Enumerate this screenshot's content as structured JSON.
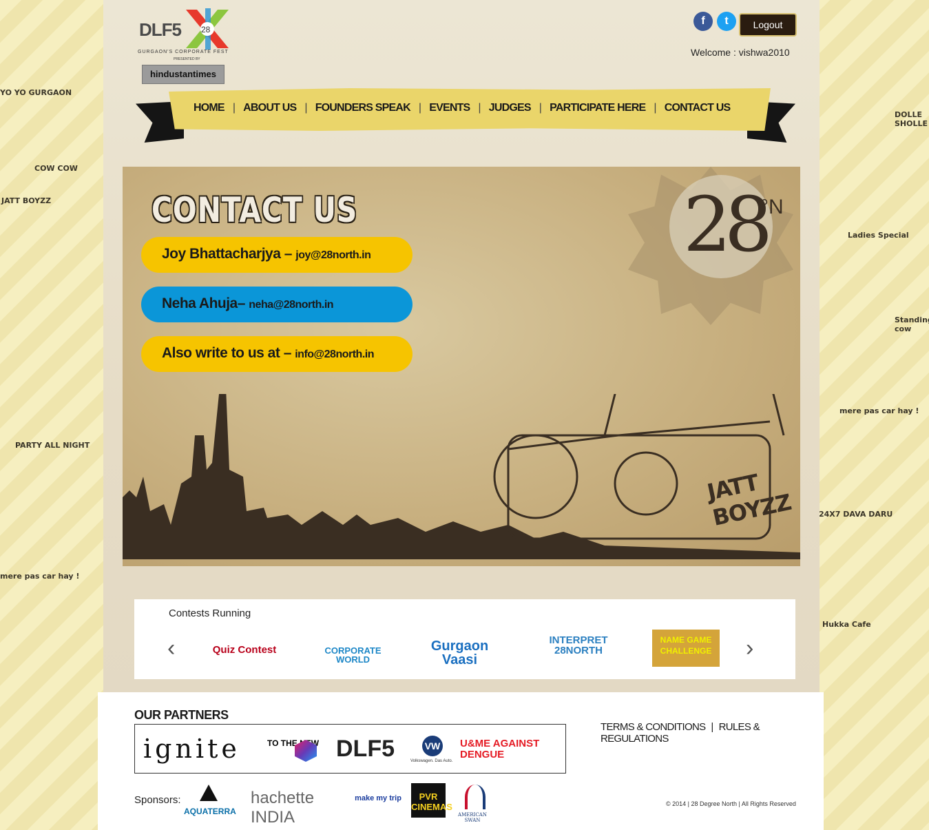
{
  "header": {
    "logo": {
      "brand": "DLF5",
      "badge": "28",
      "tagline": "GURGAON'S CORPORATE FEST",
      "presented_by": "PRESENTED BY",
      "partner": "hindustantimes"
    },
    "social": [
      {
        "name": "facebook-icon",
        "glyph": "f",
        "color": "#3b5998"
      },
      {
        "name": "twitter-icon",
        "glyph": "t",
        "color": "#1da1f2"
      }
    ],
    "logout_label": "Logout",
    "welcome": "Welcome : vishwa2010"
  },
  "nav": {
    "items": [
      "HOME",
      "ABOUT US",
      "FOUNDERS SPEAK",
      "EVENTS",
      "JUDGES",
      "PARTICIPATE HERE",
      "CONTACT US"
    ],
    "separator": "|"
  },
  "hero": {
    "title": "CONTACT US",
    "contacts": [
      {
        "name": "Joy Bhattacharjya –",
        "email": "joy@28north.in",
        "color": "#f6c400"
      },
      {
        "name": "Neha Ahuja–",
        "email": "neha@28north.in",
        "color": "#0b96d8"
      },
      {
        "name": "Also write to us at –",
        "email": "info@28north.in",
        "color": "#f6c400"
      }
    ],
    "seal": {
      "number": "28",
      "suffix": "°N"
    },
    "jeep_text": "JATT BOYZZ"
  },
  "contests": {
    "label": "Contests Running",
    "prev_glyph": "‹",
    "next_glyph": "›",
    "logos": [
      {
        "text": "Quiz Contest",
        "color": "#b8001a"
      },
      {
        "text": "CORPORATE WORLD",
        "color": "#1d87c7"
      },
      {
        "text": "Gurgaon Vaasi",
        "color": "#1a6fc0"
      },
      {
        "text": "INTERPRET 28NORTH",
        "color": "#2a7fc0"
      },
      {
        "text": "NAME GAME CHALLENGE",
        "color": "#f0c800"
      }
    ]
  },
  "footer": {
    "partners_title": "OUR PARTNERS",
    "partners": [
      "ignite",
      "TO THE NEW",
      "DLF5",
      "Volkswagen. Das Auto.",
      "U&ME AGAINST DENGUE"
    ],
    "links": [
      "TERMS & CONDITIONS",
      "RULES & REGULATIONS"
    ],
    "link_separator": "|",
    "sponsors_label": "Sponsors:",
    "sponsors": [
      "AQUATERRA",
      "hachette INDIA",
      "make my trip",
      "PVR CINEMAS",
      "AMERICAN SWAN"
    ],
    "copyright": "© 2014 | 28 Degree North | All Rights Reserved"
  },
  "doodles": [
    "YO YO GURGAON",
    "COW COW",
    "JATT BOYZZ",
    "PARTY ALL NIGHT",
    "mere pas car hay !",
    "DOLLE SHOLLE",
    "Ladies Special",
    "Standing cow",
    "24X7 DAVA DARU",
    "Hukka Cafe"
  ],
  "colors": {
    "accent_yellow": "#f6c400",
    "accent_blue": "#0b96d8",
    "ribbon": "#ead56a"
  }
}
